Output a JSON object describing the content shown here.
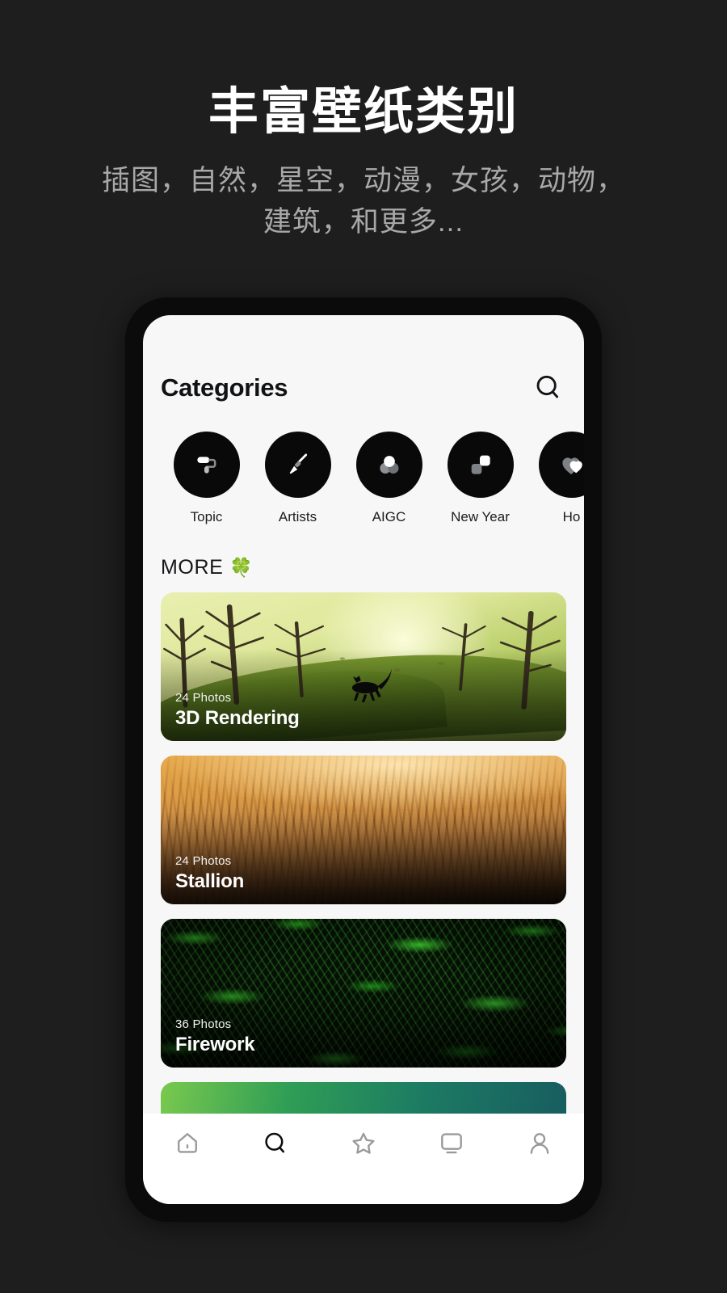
{
  "promo": {
    "headline": "丰富壁纸类别",
    "subhead": "插图，自然，星空，动漫，女孩，动物，建筑，和更多...",
    "background_color": "#1e1e1e",
    "headline_color": "#ffffff",
    "subhead_color": "#a8a8a8"
  },
  "app": {
    "title": "Categories",
    "search_icon": "search-icon",
    "screen_background": "#f7f7f7",
    "categories": [
      {
        "label": "Topic",
        "icon": "paint-roller-icon"
      },
      {
        "label": "Artists",
        "icon": "paint-brush-icon"
      },
      {
        "label": "AIGC",
        "icon": "three-circles-icon"
      },
      {
        "label": "New Year",
        "icon": "two-squares-icon"
      },
      {
        "label": "Ho",
        "icon": "heart-icon"
      }
    ],
    "more": {
      "label": "MORE",
      "emoji": "🍀"
    },
    "cards": [
      {
        "count": "24 Photos",
        "title": "3D Rendering",
        "art": "forest"
      },
      {
        "count": "24 Photos",
        "title": "Stallion",
        "art": "dune"
      },
      {
        "count": "36 Photos",
        "title": "Firework",
        "art": "fern"
      },
      {
        "count": "",
        "title": "",
        "art": "aurora"
      }
    ],
    "bottom_nav": [
      {
        "name": "home",
        "icon": "home-icon",
        "active": false
      },
      {
        "name": "search",
        "icon": "search-icon",
        "active": true
      },
      {
        "name": "favorite",
        "icon": "star-icon",
        "active": false
      },
      {
        "name": "screen",
        "icon": "monitor-icon",
        "active": false
      },
      {
        "name": "profile",
        "icon": "person-icon",
        "active": false
      }
    ]
  }
}
